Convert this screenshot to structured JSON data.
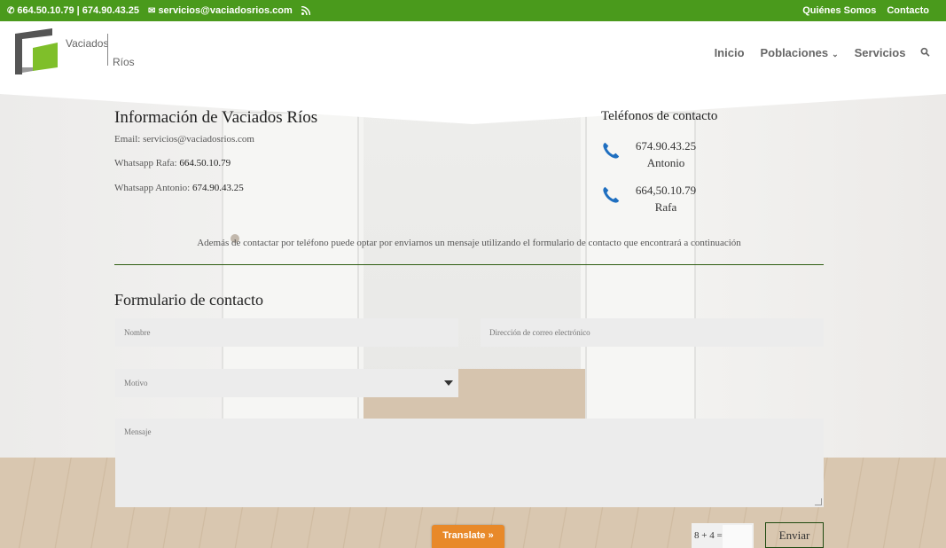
{
  "topbar": {
    "phones": "664.50.10.79 | 674.90.43.25",
    "email": "servicios@vaciadosrios.com",
    "links": [
      "Quiénes Somos",
      "Contacto"
    ]
  },
  "header": {
    "logo_line1": "Vaciados",
    "logo_line2": "Ríos",
    "nav": [
      "Inicio",
      "Poblaciones",
      "Servicios"
    ]
  },
  "info": {
    "title": "Información de Vaciados Ríos",
    "email_label": "Email: servicios@vaciadosrios.com",
    "whatsapp_rafa_label": "Whatsapp Rafa: ",
    "whatsapp_rafa_number": "664.50.10.79",
    "whatsapp_antonio_label": "Whatsapp Antonio: ",
    "whatsapp_antonio_number": "674.90.43.25"
  },
  "phones": {
    "title": "Teléfonos de contacto",
    "items": [
      {
        "number": "674.90.43.25",
        "name": "Antonio"
      },
      {
        "number": "664,50.10.79",
        "name": "Rafa"
      }
    ]
  },
  "lead": "Además de contactar por teléfono puede optar por enviarnos un mensaje utilizando el formulario de contacto que encontrará a continuación",
  "form": {
    "title": "Formulario de contacto",
    "name_placeholder": "Nombre",
    "email_placeholder": "Dirección de correo electrónico",
    "motivo_placeholder": "Motivo",
    "message_placeholder": "Mensaje",
    "captcha": "8 + 4 =",
    "send_label": "Enviar"
  },
  "translate_label": "Translate »",
  "colors": {
    "topbar": "#4a9a1c",
    "divider": "#2f5e12",
    "translate": "#e8892a",
    "phone_icon": "#1f6fc0"
  }
}
